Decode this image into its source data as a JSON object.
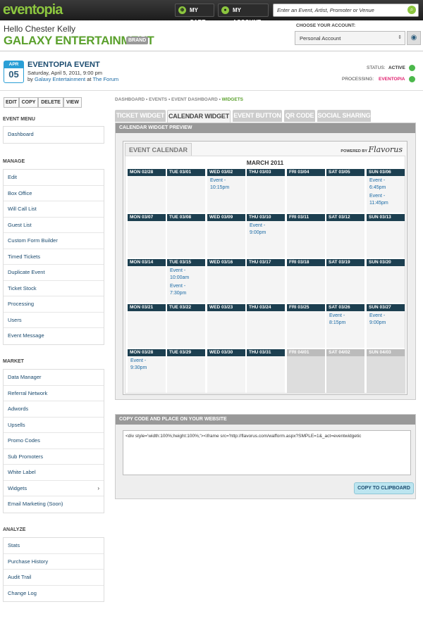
{
  "topbar": {
    "logo": "eventopia",
    "cart_label": "MY CART",
    "account_label": "MY ACCOUNT",
    "search_placeholder": "Enter an Event, Artist, Promoter or Venue"
  },
  "header": {
    "greeting": "Hello Chester Kelly",
    "brand_name": "GALAXY ENTERTAINMENT",
    "brand_tag": "BRAND",
    "choose_account_label": "CHOOSE YOUR ACCOUNT:",
    "account_selected": "Personal Account"
  },
  "event": {
    "month": "APR",
    "day": "05",
    "title": "EVENTOPIA EVENT",
    "date_line": "Saturday, April 5, 2011, 9:00 pm",
    "by_prefix": "by",
    "promoter": "Galaxy Entertainment",
    "at_word": "at",
    "venue": "The Forum",
    "status_label": "STATUS:",
    "status_value": "ACTIVE",
    "processing_label": "PROCESSING:",
    "processing_value": "EVENTOPIA",
    "status_color": "#4bb84b"
  },
  "actions": [
    "EDIT",
    "COPY",
    "DELETE",
    "VIEW"
  ],
  "sidebar": {
    "event_menu": {
      "heading": "EVENT MENU",
      "items": [
        "Dashboard"
      ]
    },
    "manage": {
      "heading": "MANAGE",
      "items": [
        "Edit",
        "Box Office",
        "Will Call List",
        "Guest List",
        "Custom Form Builder",
        "Timed Tickets",
        "Duplicate Event",
        "Ticket Stock",
        "Processing",
        "Users",
        "Event Message"
      ]
    },
    "market": {
      "heading": "MARKET",
      "items": [
        "Data Manager",
        "Referral Network",
        "Adwords",
        "Upsells",
        "Promo Codes",
        "Sub Promoters",
        "White Label",
        "Widgets",
        "Email Marketing (Soon)"
      ]
    },
    "analyze": {
      "heading": "ANALYZE",
      "items": [
        "Stats",
        "Purchase History",
        "Audit Trail",
        "Change Log"
      ]
    }
  },
  "breadcrumb": {
    "items": [
      "DASHBOARD",
      "EVENTS",
      "EVENT DASHBOARD"
    ],
    "current": "WIDGETS"
  },
  "tabs": [
    "TICKET WIDGET",
    "CALENDAR WIDGET",
    "EVENT BUTTON",
    "QR CODE",
    "SOCIAL SHARING"
  ],
  "active_tab": "CALENDAR WIDGET",
  "preview": {
    "heading": "CALENDAR WIDGET PREVIEW",
    "calendar_tab": "EVENT CALENDAR",
    "powered_by": "POWERED BY",
    "powered_brand": "Flavorus",
    "month": "MARCH 2011",
    "weeks": [
      [
        {
          "label": "MON 02/28",
          "events": []
        },
        {
          "label": "TUE 03/01",
          "events": []
        },
        {
          "label": "WED 03/02",
          "events": [
            "Event - 10:15pm"
          ]
        },
        {
          "label": "THU 03/03",
          "events": []
        },
        {
          "label": "FRI 03/04",
          "events": []
        },
        {
          "label": "SAT 03/05",
          "events": []
        },
        {
          "label": "SUN 03/06",
          "events": [
            "Event - 6:45pm",
            "Event - 11:45pm"
          ]
        }
      ],
      [
        {
          "label": "MON 03/07",
          "events": []
        },
        {
          "label": "TUE 03/08",
          "events": []
        },
        {
          "label": "WED 03/09",
          "events": []
        },
        {
          "label": "THU 03/10",
          "events": [
            "Event - 9:00pm"
          ]
        },
        {
          "label": "FRI 03/11",
          "events": []
        },
        {
          "label": "SAT 03/12",
          "events": []
        },
        {
          "label": "SUN 03/13",
          "events": []
        }
      ],
      [
        {
          "label": "MON 03/14",
          "events": []
        },
        {
          "label": "TUE 03/15",
          "events": [
            "Event - 10:00am",
            "Event - 7:30pm"
          ]
        },
        {
          "label": "WED 03/16",
          "events": []
        },
        {
          "label": "THU 03/17",
          "events": []
        },
        {
          "label": "FRI 03/18",
          "events": []
        },
        {
          "label": "SAT 03/19",
          "events": []
        },
        {
          "label": "SUN 03/20",
          "events": []
        }
      ],
      [
        {
          "label": "MON 03/21",
          "events": []
        },
        {
          "label": "TUE 03/22",
          "events": []
        },
        {
          "label": "WED 03/23",
          "events": []
        },
        {
          "label": "THU 03/24",
          "events": []
        },
        {
          "label": "FRI 03/25",
          "events": []
        },
        {
          "label": "SAT 03/26",
          "events": [
            "Event - 8:15pm"
          ]
        },
        {
          "label": "SUN 03/27",
          "events": [
            "Event - 9:00pm"
          ]
        }
      ],
      [
        {
          "label": "MON 03/28",
          "events": [
            "Event - 9:30pm"
          ]
        },
        {
          "label": "TUE 03/29",
          "events": []
        },
        {
          "label": "WED 03/30",
          "events": []
        },
        {
          "label": "THU 03/31",
          "events": []
        },
        {
          "label": "FRI 04/01",
          "events": [],
          "other": true
        },
        {
          "label": "SAT 04/02",
          "events": [],
          "other": true
        },
        {
          "label": "SUN 04/03",
          "events": [],
          "other": true
        }
      ]
    ]
  },
  "copy_code": {
    "heading": "COPY CODE AND PLACE ON YOUR WEBSITE",
    "code": "<div style='width:100%;height:100%;'><iframe src='http://flavorus.com/wafform.aspx?SMPLE=1&_act=eventwidgetic",
    "button_label": "COPY TO CLIPBOARD"
  }
}
